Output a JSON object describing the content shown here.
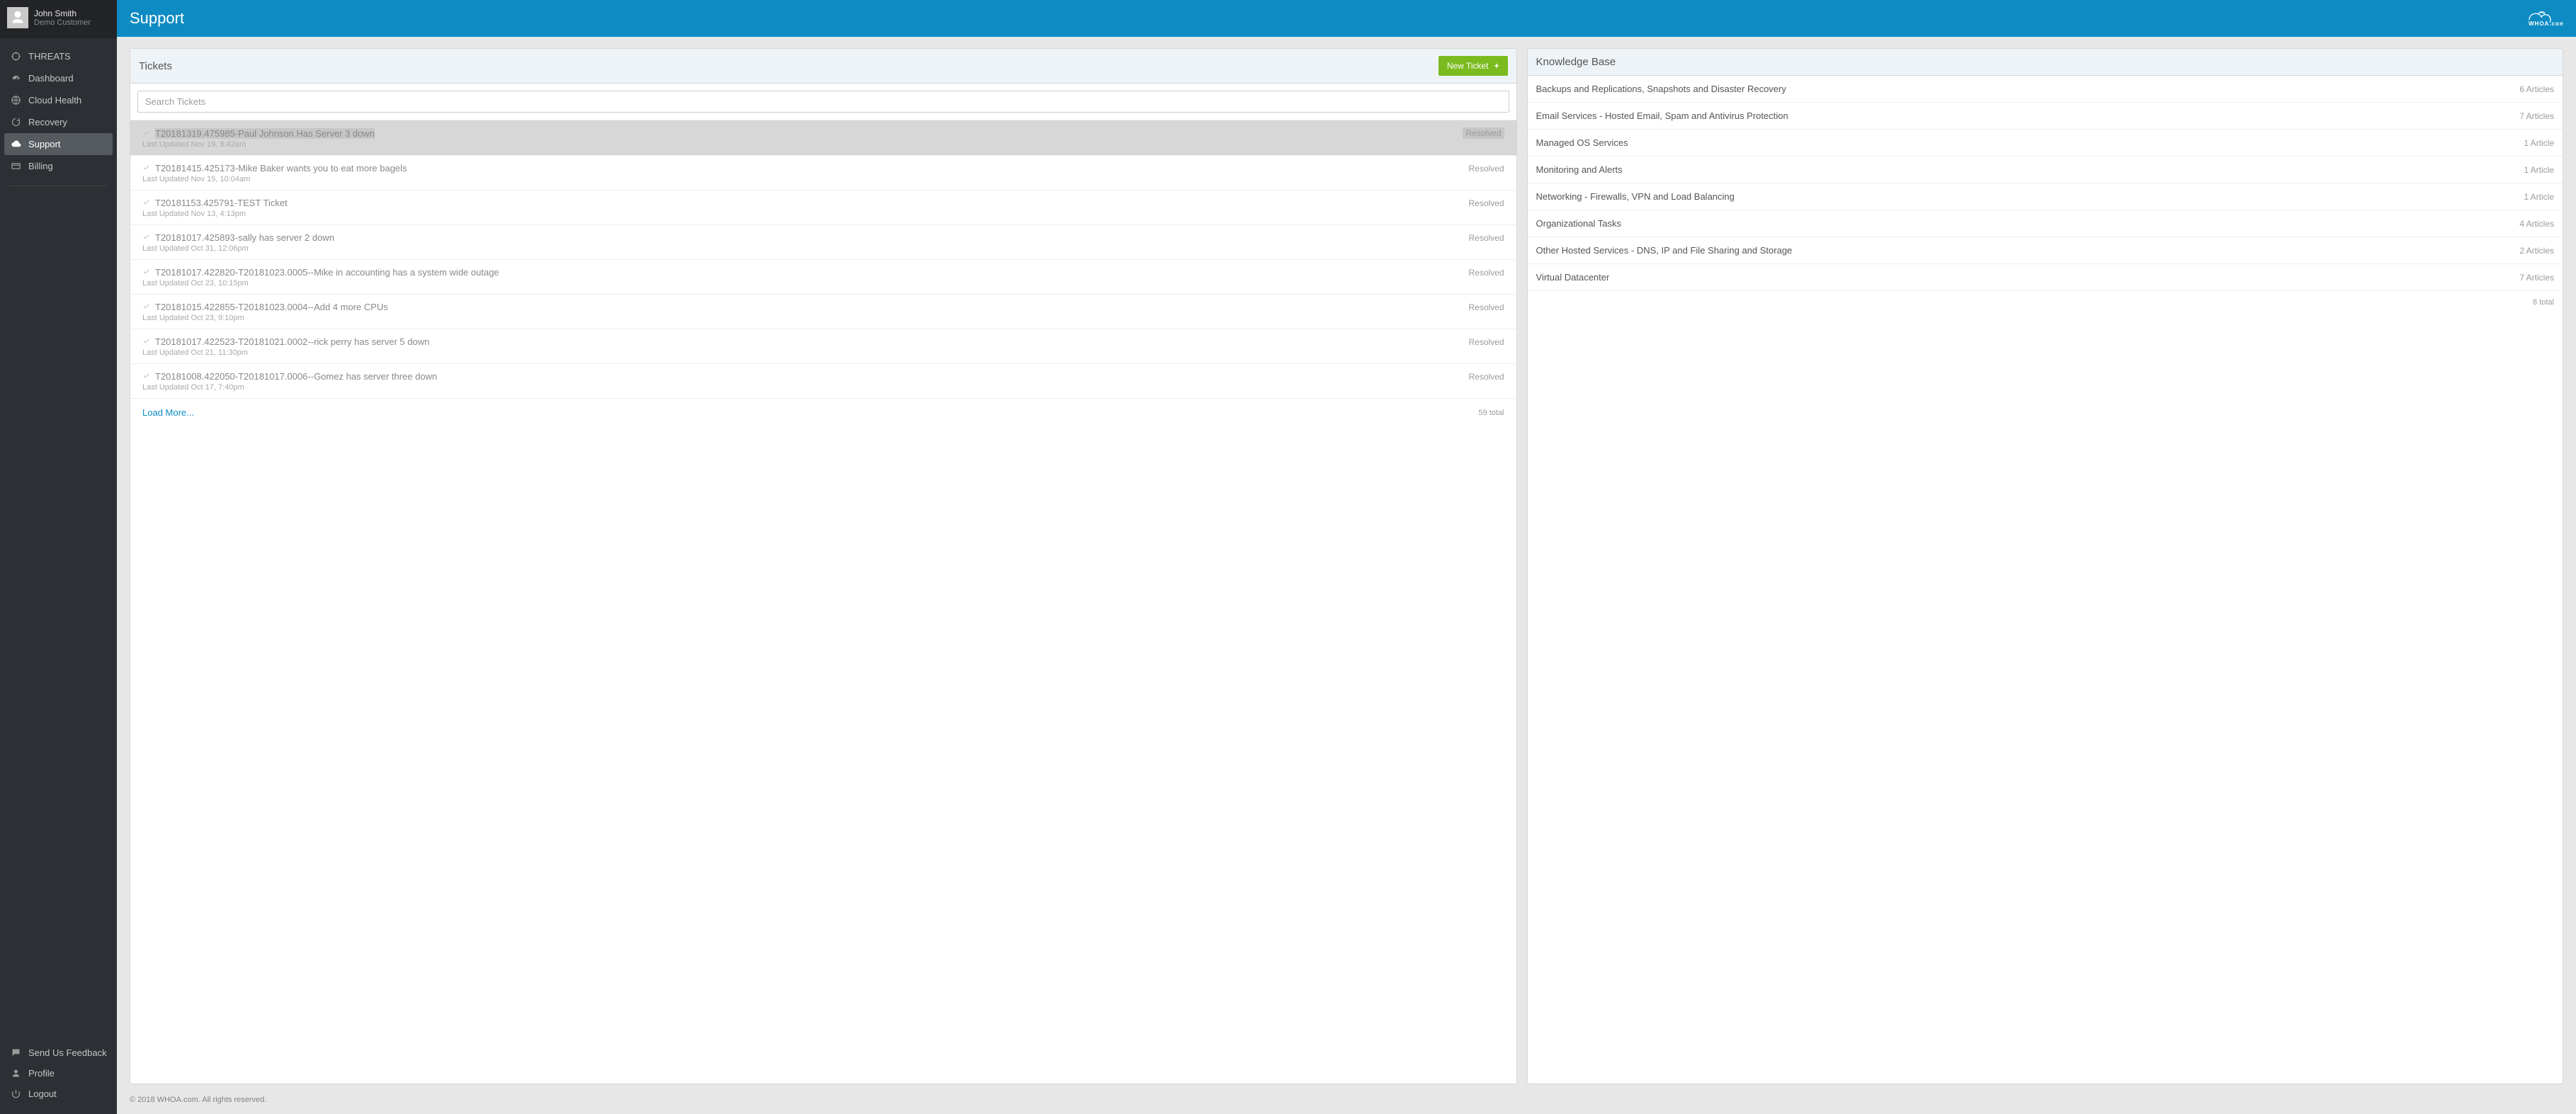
{
  "user": {
    "name": "John Smith",
    "subtitle": "Demo Customer"
  },
  "sidebar": {
    "items": [
      {
        "label": "THREATS",
        "icon": "crosshair-icon"
      },
      {
        "label": "Dashboard",
        "icon": "gauge-icon"
      },
      {
        "label": "Cloud Health",
        "icon": "globe-icon"
      },
      {
        "label": "Recovery",
        "icon": "recycle-icon"
      },
      {
        "label": "Support",
        "icon": "cloud-icon",
        "active": true
      },
      {
        "label": "Billing",
        "icon": "card-icon"
      }
    ],
    "bottom": [
      {
        "label": "Send Us Feedback",
        "icon": "chat-icon"
      },
      {
        "label": "Profile",
        "icon": "person-icon"
      },
      {
        "label": "Logout",
        "icon": "power-icon"
      }
    ]
  },
  "header": {
    "title": "Support",
    "brand": "WHOA.com"
  },
  "tickets": {
    "title": "Tickets",
    "new_label": "New Ticket",
    "search_placeholder": "Search Tickets",
    "load_more": "Load More...",
    "total": "59 total",
    "items": [
      {
        "title": "T20181319.475985-Paul Johnson Has Server 3 down",
        "status": "Resolved",
        "updated": "Last Updated Nov 19, 8:42am",
        "active": true
      },
      {
        "title": "T20181415.425173-Mike Baker wants you to eat more bagels",
        "status": "Resolved",
        "updated": "Last Updated Nov 15, 10:04am"
      },
      {
        "title": "T20181153.425791-TEST Ticket",
        "status": "Resolved",
        "updated": "Last Updated Nov 13, 4:13pm"
      },
      {
        "title": "T20181017.425893-sally has server 2 down",
        "status": "Resolved",
        "updated": "Last Updated Oct 31, 12:06pm"
      },
      {
        "title": "T20181017.422820-T20181023.0005--Mike in accounting has a system wide outage",
        "status": "Resolved",
        "updated": "Last Updated Oct 23, 10:15pm"
      },
      {
        "title": "T20181015.422855-T20181023.0004--Add 4 more CPUs",
        "status": "Resolved",
        "updated": "Last Updated Oct 23, 9:10pm"
      },
      {
        "title": "T20181017.422523-T20181021.0002--rick perry has server 5 down",
        "status": "Resolved",
        "updated": "Last Updated Oct 21, 11:30pm"
      },
      {
        "title": "T20181008.422050-T20181017.0006--Gomez has server three down",
        "status": "Resolved",
        "updated": "Last Updated Oct 17, 7:40pm"
      }
    ]
  },
  "kb": {
    "title": "Knowledge Base",
    "total": "8 total",
    "items": [
      {
        "title": "Backups and Replications, Snapshots and Disaster Recovery",
        "count": "6 Articles"
      },
      {
        "title": "Email Services - Hosted Email, Spam and Antivirus Protection",
        "count": "7 Articles"
      },
      {
        "title": "Managed OS Services",
        "count": "1 Article"
      },
      {
        "title": "Monitoring and Alerts",
        "count": "1 Article"
      },
      {
        "title": "Networking - Firewalls, VPN and Load Balancing",
        "count": "1 Article"
      },
      {
        "title": "Organizational Tasks",
        "count": "4 Articles"
      },
      {
        "title": "Other Hosted Services - DNS, IP and File Sharing and Storage",
        "count": "2 Articles"
      },
      {
        "title": "Virtual Datacenter",
        "count": "7 Articles"
      }
    ]
  },
  "footer": "© 2018 WHOA.com. All rights reserved."
}
